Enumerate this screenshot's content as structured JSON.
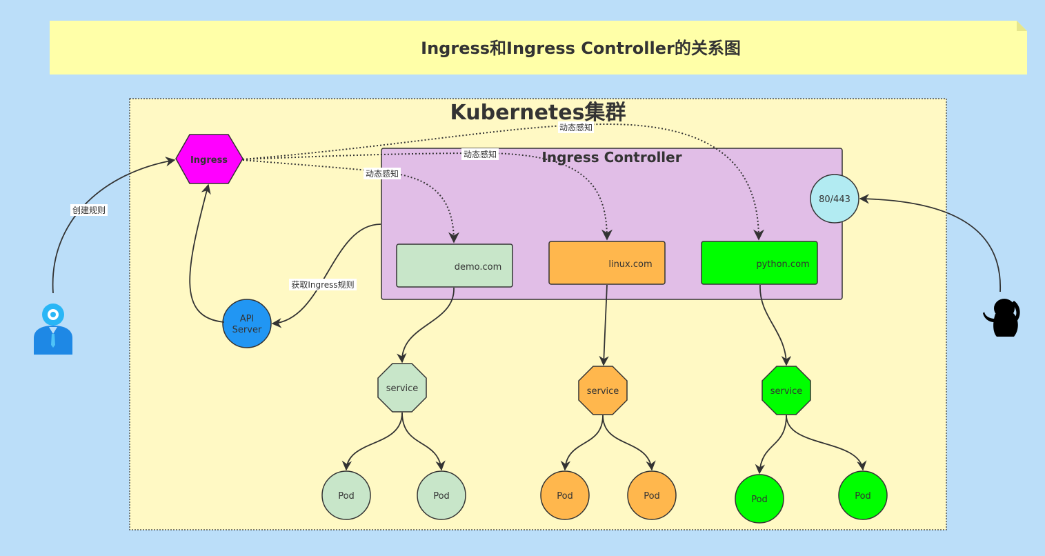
{
  "title": "Ingress和Ingress Controller的关系图",
  "cluster": {
    "label": "Kubernetes集群"
  },
  "controller": {
    "label": "Ingress Controller",
    "port": "80/443"
  },
  "ingress": {
    "label": "Ingress"
  },
  "api_server": {
    "line1": "API",
    "line2": "Server"
  },
  "hosts": [
    {
      "label": "demo.com",
      "color": "#c8e6c9"
    },
    {
      "label": "linux.com",
      "color": "#ffb74d"
    },
    {
      "label": "python.com",
      "color": "#00ff00"
    }
  ],
  "service_label": "service",
  "pod_label": "Pod",
  "edge_labels": {
    "create_rules": "创建规则",
    "fetch_rules": "获取Ingress规则",
    "watch_1": "动态感知",
    "watch_2": "动态感知",
    "watch_3": "动态感知"
  },
  "colors": {
    "background": "#bbdef9",
    "note": "#ffffa8",
    "cluster": "#fff9c4",
    "controller": "#e1bee7",
    "ingress": "#ff00ff",
    "api_server": "#2196f3",
    "port": "#b2ebf2"
  }
}
